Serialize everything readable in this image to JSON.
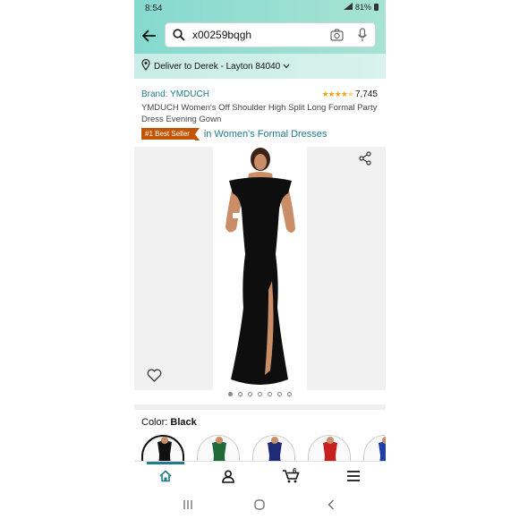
{
  "status_bar": {
    "time": "8:54",
    "battery": "81%"
  },
  "search": {
    "query": "x00259bqgh"
  },
  "delivery": {
    "text": "Deliver to Derek - Layton 84040"
  },
  "product": {
    "brand": "Brand: YMDUCH",
    "rating_stars": 4.5,
    "rating_count": "7,745",
    "title": "YMDUCH Women's Off Shoulder High Split Long Formal Party Dress Evening Gown",
    "badge": "#1 Best Seller",
    "category": "in Women's Formal Dresses"
  },
  "gallery": {
    "image_count": 7,
    "active_index": 0
  },
  "color": {
    "label": "Color:",
    "selected": "Black",
    "swatches": [
      "#111111",
      "#1f6b3a",
      "#1f2a78",
      "#c8201f",
      "#1f3fa8"
    ]
  },
  "icons": {
    "back": "arrow-left-icon",
    "search": "search-icon",
    "camera": "camera-icon",
    "mic": "mic-icon",
    "location": "location-pin-icon",
    "share": "share-icon",
    "wishlist": "heart-icon",
    "home": "home-icon",
    "account": "person-icon",
    "cart": "cart-icon",
    "menu": "menu-icon"
  },
  "bottom_nav": {
    "cart_count": "6"
  },
  "colors": {
    "teal_header": "#86d9cf",
    "link": "#1f7a8c",
    "badge": "#c45500",
    "star": "#f2a41a"
  }
}
